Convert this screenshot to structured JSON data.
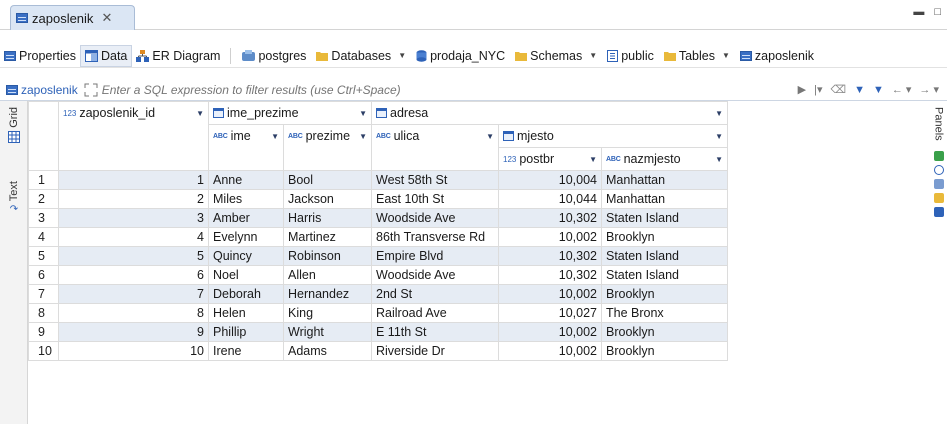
{
  "editor": {
    "tab_title": "zaposlenik",
    "close_glyph": "✕"
  },
  "subtabs": [
    {
      "label": "Properties",
      "icon": "table-icon"
    },
    {
      "label": "Data",
      "icon": "data-icon",
      "active": true
    },
    {
      "label": "ER Diagram",
      "icon": "er-diagram-icon"
    }
  ],
  "breadcrumb": [
    {
      "label": "postgres",
      "icon": "postgres-icon",
      "dropdown": false
    },
    {
      "label": "Databases",
      "icon": "folder-icon",
      "dropdown": true
    },
    {
      "label": "prodaja_NYC",
      "icon": "database-icon",
      "dropdown": false
    },
    {
      "label": "Schemas",
      "icon": "folder-icon",
      "dropdown": true
    },
    {
      "label": "public",
      "icon": "schema-icon",
      "dropdown": false
    },
    {
      "label": "Tables",
      "icon": "folder-icon",
      "dropdown": true
    },
    {
      "label": "zaposlenik",
      "icon": "table-icon",
      "dropdown": false
    }
  ],
  "filter": {
    "table_label": "zaposlenik",
    "placeholder": "Enter a SQL expression to filter results (use Ctrl+Space)"
  },
  "side_tabs": {
    "grid": "Grid",
    "text": "Text",
    "panels": "Panels"
  },
  "columns": {
    "id": "zaposlenik_id",
    "ime_prezime": "ime_prezime",
    "ime": "ime",
    "prezime": "prezime",
    "adresa": "adresa",
    "ulica": "ulica",
    "mjesto": "mjesto",
    "postbr": "postbr",
    "nazmjesto": "nazmjesto"
  },
  "rows": [
    {
      "n": "1",
      "id": "1",
      "ime": "Anne",
      "prezime": "Bool",
      "ulica": "West 58th St",
      "postbr": "10,004",
      "nazmjesto": "Manhattan"
    },
    {
      "n": "2",
      "id": "2",
      "ime": "Miles",
      "prezime": "Jackson",
      "ulica": "East 10th St",
      "postbr": "10,044",
      "nazmjesto": "Manhattan"
    },
    {
      "n": "3",
      "id": "3",
      "ime": "Amber",
      "prezime": "Harris",
      "ulica": "Woodside Ave",
      "postbr": "10,302",
      "nazmjesto": "Staten Island"
    },
    {
      "n": "4",
      "id": "4",
      "ime": "Evelynn",
      "prezime": "Martinez",
      "ulica": "86th Transverse Rd",
      "postbr": "10,002",
      "nazmjesto": "Brooklyn"
    },
    {
      "n": "5",
      "id": "5",
      "ime": "Quincy",
      "prezime": "Robinson",
      "ulica": "Empire Blvd",
      "postbr": "10,302",
      "nazmjesto": "Staten Island"
    },
    {
      "n": "6",
      "id": "6",
      "ime": "Noel",
      "prezime": "Allen",
      "ulica": "Woodside Ave",
      "postbr": "10,302",
      "nazmjesto": "Staten Island"
    },
    {
      "n": "7",
      "id": "7",
      "ime": "Deborah",
      "prezime": "Hernandez",
      "ulica": "2nd St",
      "postbr": "10,002",
      "nazmjesto": "Brooklyn"
    },
    {
      "n": "8",
      "id": "8",
      "ime": "Helen",
      "prezime": "King",
      "ulica": "Railroad Ave",
      "postbr": "10,027",
      "nazmjesto": "The Bronx"
    },
    {
      "n": "9",
      "id": "9",
      "ime": "Phillip",
      "prezime": "Wright",
      "ulica": "E 11th St",
      "postbr": "10,002",
      "nazmjesto": "Brooklyn"
    },
    {
      "n": "10",
      "id": "10",
      "ime": "Irene",
      "prezime": "Adams",
      "ulica": "Riverside Dr",
      "postbr": "10,002",
      "nazmjesto": "Brooklyn"
    }
  ],
  "colors": {
    "accent": "#2e62b8",
    "row_alt": "#e6ecf4"
  }
}
